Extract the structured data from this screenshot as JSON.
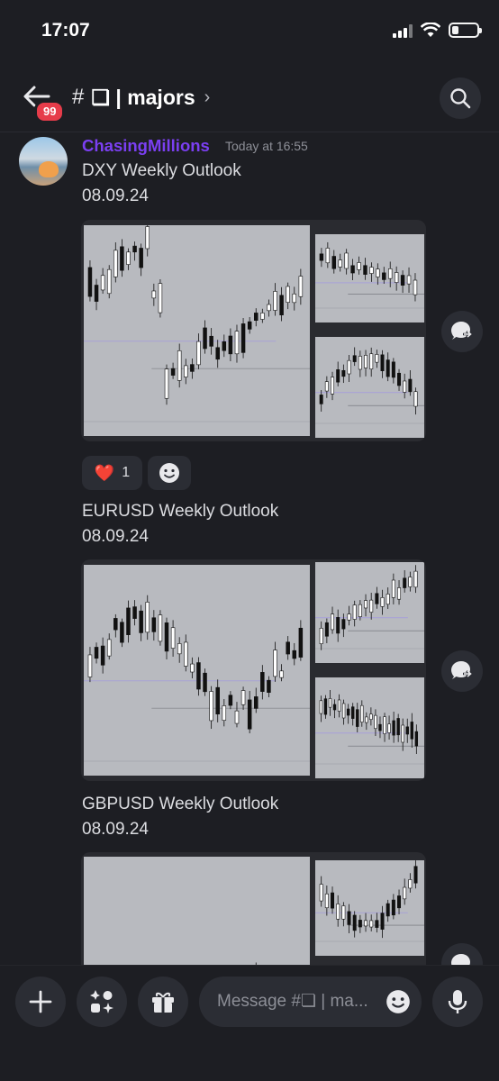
{
  "status_bar": {
    "time": "17:07"
  },
  "header": {
    "unread_badge": "99",
    "channel_name": "❏ | majors",
    "hash": "#",
    "chevron": "›"
  },
  "message": {
    "username": "ChasingMillions",
    "timestamp": "Today at 16:55",
    "posts": [
      {
        "title": "DXY Weekly Outlook",
        "date": "08.09.24"
      },
      {
        "title": "EURUSD Weekly Outlook",
        "date": "08.09.24"
      },
      {
        "title": "GBPUSD Weekly Outlook",
        "date": "08.09.24"
      }
    ],
    "reactions": {
      "heart_emoji": "❤️",
      "heart_count": "1"
    }
  },
  "composer": {
    "placeholder": "Message #❏ | ma..."
  },
  "colors": {
    "background": "#1d1e23",
    "username": "#7b3ff2",
    "badge": "#e63c4a",
    "chart_bg": "#b8babf"
  }
}
